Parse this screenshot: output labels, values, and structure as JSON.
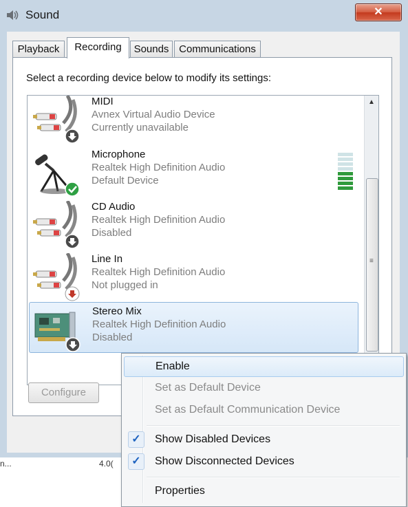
{
  "window": {
    "title": "Sound",
    "close_label": "✕"
  },
  "tabs": [
    {
      "label": "Playback"
    },
    {
      "label": "Recording"
    },
    {
      "label": "Sounds"
    },
    {
      "label": "Communications"
    }
  ],
  "instruction": "Select a recording device below to modify its settings:",
  "devices": [
    {
      "name": "MIDI",
      "line1": "Avnex Virtual Audio Device",
      "line2": "Currently unavailable",
      "icon": "rca-cable-icon",
      "status_icon": "disabled-arrow-icon"
    },
    {
      "name": "Microphone",
      "line1": "Realtek High Definition Audio",
      "line2": "Default Device",
      "icon": "microphone-icon",
      "status_icon": "default-check-icon"
    },
    {
      "name": "CD Audio",
      "line1": "Realtek High Definition Audio",
      "line2": "Disabled",
      "icon": "rca-cable-icon",
      "status_icon": "disabled-arrow-icon"
    },
    {
      "name": "Line In",
      "line1": "Realtek High Definition Audio",
      "line2": "Not plugged in",
      "icon": "rca-cable-icon",
      "status_icon": "unplugged-arrow-icon"
    },
    {
      "name": "Stereo Mix",
      "line1": "Realtek High Definition Audio",
      "line2": "Disabled",
      "icon": "sound-card-icon",
      "status_icon": "disabled-arrow-icon"
    }
  ],
  "buttons": {
    "configure": "Configure"
  },
  "behind_text": {
    "left": "n...",
    "right": "4.0("
  },
  "context_menu": {
    "items": [
      {
        "label": "Enable",
        "enabled": true,
        "checked": false
      },
      {
        "label": "Set as Default Device",
        "enabled": false,
        "checked": false
      },
      {
        "label": "Set as Default Communication Device",
        "enabled": false,
        "checked": false
      },
      {
        "label": "Show Disabled Devices",
        "enabled": true,
        "checked": true
      },
      {
        "label": "Show Disconnected Devices",
        "enabled": true,
        "checked": true
      },
      {
        "label": "Properties",
        "enabled": true,
        "checked": false
      }
    ],
    "check_glyph": "✓"
  },
  "colors": {
    "level_active": "#2f9a3c",
    "level_inactive": "#cfe3e6",
    "check_badge": "#2ea043",
    "disabled_badge": "#4a4a4a",
    "unplugged_badge": "#c0392b"
  }
}
